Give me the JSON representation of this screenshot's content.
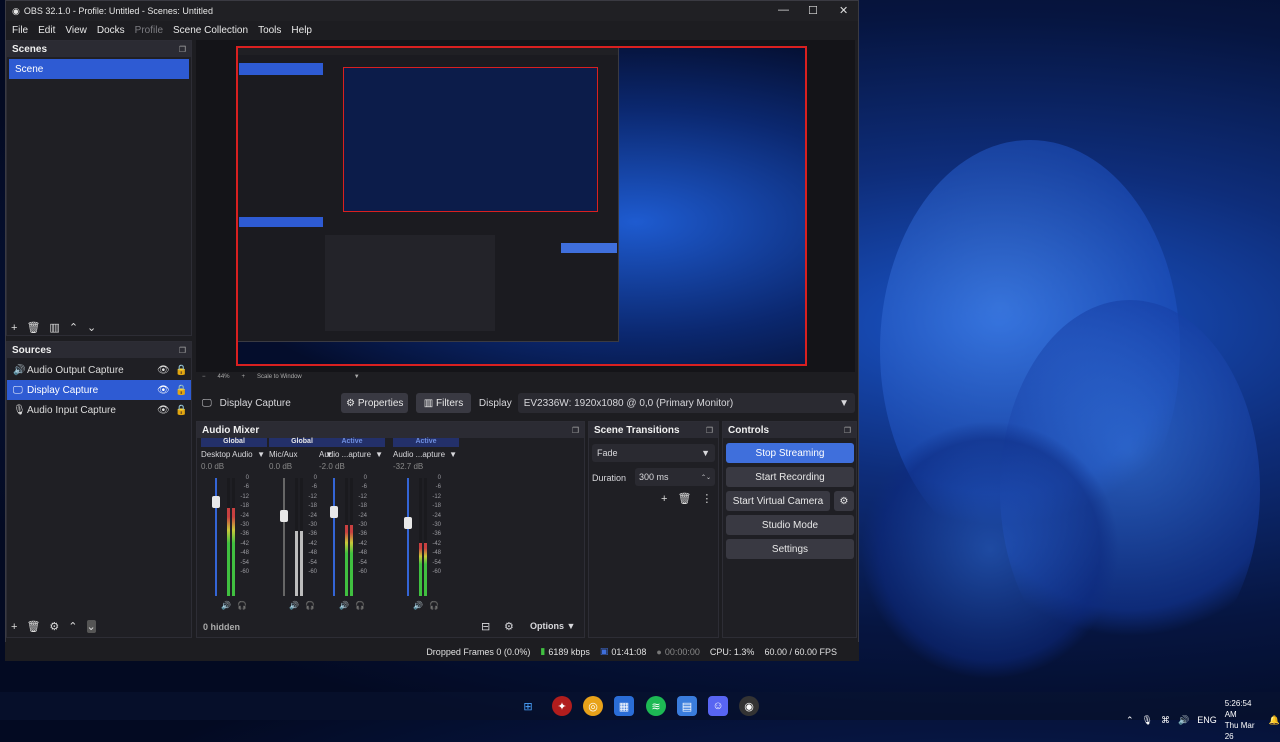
{
  "window": {
    "title": "OBS 32.1.0 - Profile: Untitled - Scenes: Untitled",
    "min": "—",
    "max": "☐",
    "close": "✕"
  },
  "menu": [
    "File",
    "Edit",
    "View",
    "Docks",
    "Profile",
    "Scene Collection",
    "Tools",
    "Help"
  ],
  "scenes": {
    "title": "Scenes",
    "items": [
      "Scene"
    ]
  },
  "sources": {
    "title": "Sources",
    "items": [
      "Audio Output Capture",
      "Display Capture",
      "Audio Input Capture"
    ]
  },
  "preview": {
    "zoom": "44%",
    "mode": "Scale to Window"
  },
  "source_toolbar": {
    "name": "Display Capture",
    "properties": "Properties",
    "filters": "Filters",
    "display_label": "Display",
    "display_value": "EV2336W: 1920x1080 @ 0,0 (Primary Monitor)"
  },
  "mixer": {
    "title": "Audio Mixer",
    "hidden": "0 hidden",
    "options": "Options",
    "channels": [
      {
        "tag": "Global",
        "name": "Desktop Audio",
        "db": "0.0 dB",
        "level": 0.75
      },
      {
        "tag": "Global",
        "name": "Mic/Aux",
        "db": "0.0 dB",
        "level": 0.55
      },
      {
        "tag": "Active",
        "name": "Audio ...apture",
        "db": "-2.0 dB",
        "level": 0.6
      },
      {
        "tag": "Active",
        "name": "Audio ...apture",
        "db": "-32.7 dB",
        "level": 0.45
      }
    ],
    "scale": [
      "0",
      "-6",
      "-12",
      "-18",
      "-24",
      "-30",
      "-36",
      "-42",
      "-48",
      "-54",
      "-60"
    ]
  },
  "transitions": {
    "title": "Scene Transitions",
    "selected": "Fade",
    "duration_label": "Duration",
    "duration_value": "300 ms"
  },
  "controls": {
    "title": "Controls",
    "stop_streaming": "Stop Streaming",
    "start_recording": "Start Recording",
    "start_virtual_camera": "Start Virtual Camera",
    "studio_mode": "Studio Mode",
    "settings": "Settings"
  },
  "status": {
    "dropped": "Dropped Frames 0 (0.0%)",
    "kbps": "6189 kbps",
    "stream_time": "01:41:08",
    "rec_time": "00:00:00",
    "cpu": "CPU: 1.3%",
    "fps": "60.00 / 60.00 FPS"
  },
  "tray": {
    "lang": "ENG",
    "time": "5:26:54 AM",
    "date": "Thu Mar 26"
  },
  "colors": {
    "accent": "#2e5bd3",
    "streaming": "#3f6fdc",
    "selection_box": "#d92020"
  }
}
